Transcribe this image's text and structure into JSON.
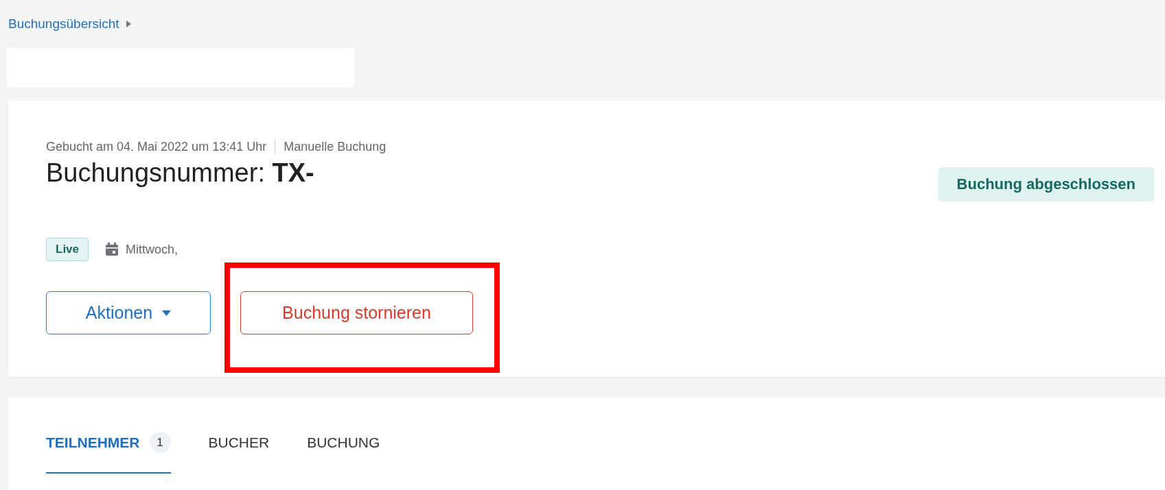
{
  "breadcrumb": {
    "label": "Buchungsübersicht"
  },
  "booking": {
    "meta": [
      "Gebucht am 04. Mai 2022 um 13:41 Uhr",
      "Manuelle Buchung"
    ],
    "title_label": "Buchungsnummer:",
    "title_value": "TX-",
    "status": "Buchung abgeschlossen",
    "live_badge": "Live",
    "date": "Mittwoch,",
    "buttons": [
      {
        "kind": "dropdown",
        "label": "Aktionen"
      },
      {
        "kind": "danger",
        "label": "Buchung stornieren",
        "highlighted": true
      }
    ]
  },
  "tabs": [
    {
      "label": "TEILNEHMER",
      "count": "1",
      "selected": true
    },
    {
      "label": "BUCHER",
      "selected": false
    },
    {
      "label": "BUCHUNG",
      "selected": false
    }
  ]
}
